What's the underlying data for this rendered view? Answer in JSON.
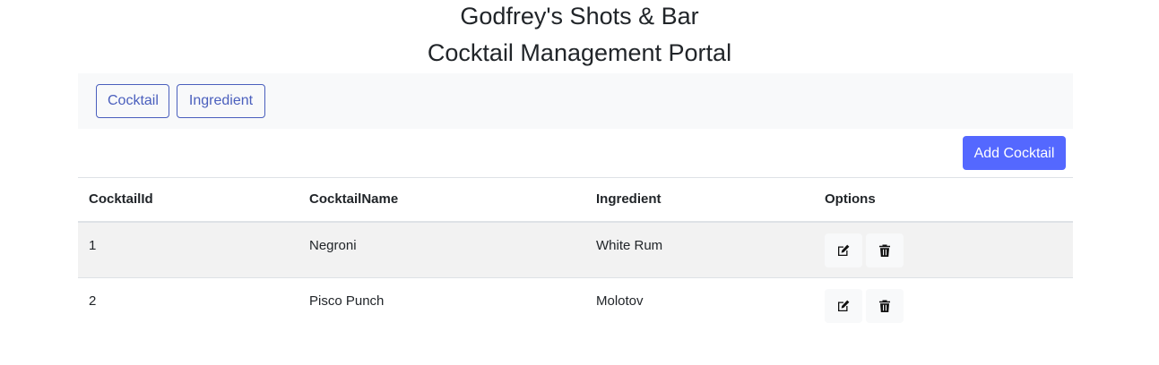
{
  "header": {
    "title_line1": "Godfrey's Shots & Bar",
    "title_line2": "Cocktail Management Portal"
  },
  "nav": {
    "cocktail_label": "Cocktail",
    "ingredient_label": "Ingredient"
  },
  "toolbar": {
    "add_label": "Add Cocktail"
  },
  "table": {
    "columns": [
      "CocktailId",
      "CocktailName",
      "Ingredient",
      "Options"
    ],
    "rows": [
      {
        "id": "1",
        "name": "Negroni",
        "ingredient": "White Rum"
      },
      {
        "id": "2",
        "name": "Pisco Punch",
        "ingredient": "Molotov"
      }
    ]
  },
  "icons": {
    "edit": "edit-icon",
    "delete": "trash-icon"
  },
  "colors": {
    "accent": "#5468ff",
    "nav_outline": "#4a5fbd",
    "navbar_bg": "#f8f9fa",
    "striped_row": "#f2f2f2"
  }
}
